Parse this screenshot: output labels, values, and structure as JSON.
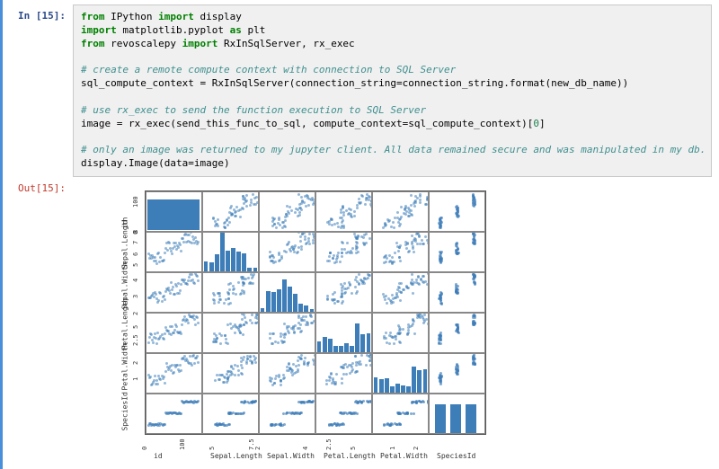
{
  "prompts": {
    "in": "In [15]:",
    "out": "Out[15]:"
  },
  "code": {
    "l1_from": "from",
    "l1_mod": "IPython",
    "l1_imp": "import",
    "l1_name": "display",
    "l2_imp": "import",
    "l2_mod": "matplotlib.pyplot",
    "l2_as": "as",
    "l2_alias": "plt",
    "l3_from": "from",
    "l3_mod": "revoscalepy",
    "l3_imp": "import",
    "l3_names": "RxInSqlServer, rx_exec",
    "c1": "# create a remote compute context with connection to SQL Server",
    "l4": "sql_compute_context = RxInSqlServer(connection_string=connection_string.format(new_db_name))",
    "c2": "# use rx_exec to send the function execution to SQL Server",
    "l5a": "image = rx_exec(send_this_func_to_sql, compute_context=sql_compute_context)[",
    "l5num": "0",
    "l5b": "]",
    "c3": "# only an image was returned to my jupyter client. All data remained secure and was manipulated in my db.",
    "l6": "display.Image(data=image)"
  },
  "chart_data": {
    "type": "pairplot",
    "vars": [
      "id",
      "Sepal.Length",
      "Sepal.Width",
      "Petal.Length",
      "Petal.Width",
      "SpeciesId"
    ],
    "y_ticks": {
      "id": [
        0,
        100
      ],
      "Sepal.Length": [
        5,
        6,
        7,
        8
      ],
      "Sepal.Width": [
        2,
        3,
        4
      ],
      "Petal.Length": [
        2.5,
        5.0
      ],
      "Petal.Width": [
        1,
        2
      ],
      "SpeciesId": []
    },
    "x_ticks": {
      "id": [
        0,
        100
      ],
      "Sepal.Length": [
        5.0,
        7.5
      ],
      "Sepal.Width": [
        2,
        4
      ],
      "Petal.Length": [
        2.5,
        5.0
      ],
      "Petal.Width": [
        1,
        2
      ],
      "SpeciesId": []
    },
    "ranges": {
      "id": [
        0,
        150
      ],
      "Sepal.Length": [
        4.3,
        7.9
      ],
      "Sepal.Width": [
        2.0,
        4.4
      ],
      "Petal.Length": [
        1.0,
        6.9
      ],
      "Petal.Width": [
        0.1,
        2.5
      ],
      "SpeciesId": [
        1,
        3
      ]
    }
  }
}
